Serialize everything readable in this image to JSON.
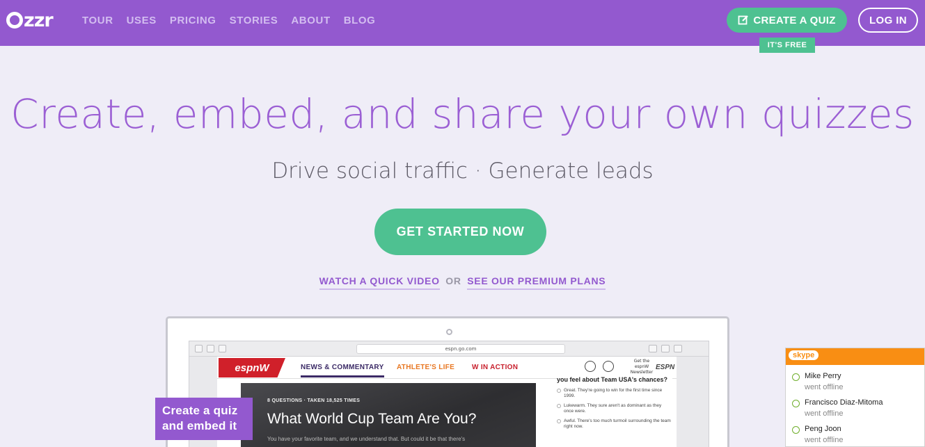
{
  "header": {
    "logo": "zzr",
    "nav": [
      "TOUR",
      "USES",
      "PRICING",
      "STORIES",
      "ABOUT",
      "BLOG"
    ],
    "create_label": "CREATE A QUIZ",
    "free_tag": "IT'S FREE",
    "login_label": "LOG IN",
    "colors": {
      "bar": "#9359cf",
      "accent": "#4ec191"
    }
  },
  "hero": {
    "title": "Create, embed, and share your own quizzes",
    "subtitle": "Drive social traffic · Generate leads",
    "cta": "GET STARTED NOW",
    "link_video": "WATCH A QUICK VIDEO",
    "or": "OR",
    "link_plans": "SEE OUR PREMIUM PLANS"
  },
  "mock": {
    "url": "espn.go.com",
    "brand": "espnW",
    "tabs": [
      "NEWS & COMMENTARY",
      "ATHLETE'S LIFE",
      "W IN ACTION"
    ],
    "newsletter": "Get the espnW Newsletter",
    "espn_small": "ESPN",
    "quiz_meta": "8 QUESTIONS · TAKEN 18,525 TIMES",
    "quiz_title": "What World Cup Team Are You?",
    "quiz_desc": "You have your favorite team, and we understand that. But could it be that there's",
    "poll_title": "you feel about Team USA's chances?",
    "poll_options": [
      "Great. They're going to win for the first time since 1999.",
      "Lukewarm. They sure aren't as dominant as they once were.",
      "Awful. There's too much turmoil surrounding the team right now."
    ]
  },
  "callout": {
    "line1": "Create a quiz",
    "line2": "and embed it"
  },
  "skype": {
    "brand": "skype",
    "contacts": [
      {
        "name": "Mike Perry",
        "status": "went offline"
      },
      {
        "name": "Francisco Diaz-Mitoma",
        "status": "went offline"
      },
      {
        "name": "Peng Joon",
        "status": "went offline"
      }
    ]
  }
}
